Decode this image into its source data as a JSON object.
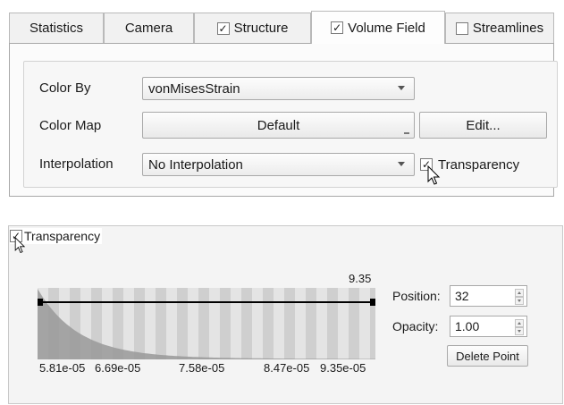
{
  "tabs": [
    {
      "label": "Statistics",
      "checkbox": false,
      "active": false
    },
    {
      "label": "Camera",
      "checkbox": false,
      "active": false
    },
    {
      "label": "Structure",
      "checkbox": true,
      "checked": true,
      "active": false
    },
    {
      "label": "Volume Field",
      "checkbox": true,
      "checked": true,
      "active": true
    },
    {
      "label": "Streamlines",
      "checkbox": true,
      "checked": false,
      "active": false
    }
  ],
  "volume_field": {
    "color_by_label": "Color By",
    "color_by_value": "vonMisesStrain",
    "color_map_label": "Color Map",
    "color_map_value": "Default",
    "edit_button": "Edit...",
    "interpolation_label": "Interpolation",
    "interpolation_value": "No Interpolation",
    "transparency_label": "Transparency",
    "transparency_checked": true
  },
  "transparency_panel": {
    "title": "Transparency",
    "checked": true,
    "max_value_label": "9.35",
    "x_tick_labels": [
      "5.81e-05",
      "6.69e-05",
      "7.58e-05",
      "8.47e-05",
      "9.35e-05"
    ],
    "position_label": "Position:",
    "position_value": "32",
    "opacity_label": "Opacity:",
    "opacity_value": "1.00",
    "delete_button": "Delete Point"
  },
  "colors": {
    "checker_light": "#e4e4e4",
    "checker_dark": "#cfcfcf",
    "histogram_fill": "#999999",
    "transfer_line": "#000000"
  }
}
